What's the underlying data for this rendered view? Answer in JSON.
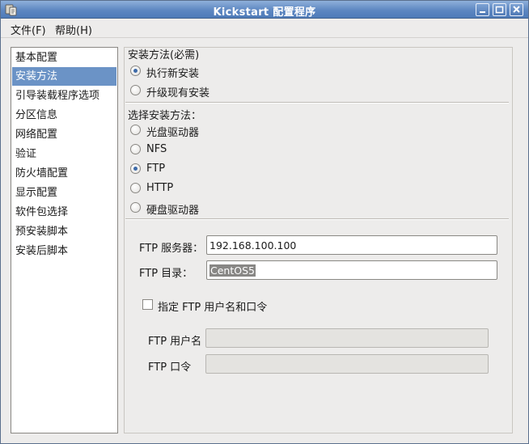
{
  "window": {
    "title": "Kickstart 配置程序",
    "controls": {
      "minimize": "minimize",
      "maximize": "maximize",
      "close": "close"
    }
  },
  "menubar": {
    "file": "文件(F)",
    "help": "帮助(H)"
  },
  "sidebar": {
    "items": [
      {
        "label": "基本配置"
      },
      {
        "label": "安装方法"
      },
      {
        "label": "引导装载程序选项"
      },
      {
        "label": "分区信息"
      },
      {
        "label": "网络配置"
      },
      {
        "label": "验证"
      },
      {
        "label": "防火墙配置"
      },
      {
        "label": "显示配置"
      },
      {
        "label": "软件包选择"
      },
      {
        "label": "预安装脚本"
      },
      {
        "label": "安装后脚本"
      }
    ],
    "selected": "安装方法"
  },
  "install_method": {
    "frame_label": "安装方法(必需)",
    "options": [
      {
        "label": "执行新安装",
        "checked": true
      },
      {
        "label": "升级现有安装",
        "checked": false
      }
    ]
  },
  "source": {
    "heading": "选择安装方法：",
    "options": [
      {
        "label": "光盘驱动器",
        "checked": false
      },
      {
        "label": "NFS",
        "checked": false
      },
      {
        "label": "FTP",
        "checked": true
      },
      {
        "label": "HTTP",
        "checked": false
      },
      {
        "label": "硬盘驱动器",
        "checked": false
      }
    ]
  },
  "ftp": {
    "server_label": "FTP 服务器：",
    "server_value": "192.168.100.100",
    "dir_label": "FTP 目录：",
    "dir_value": "CentOS5",
    "auth_checkbox_label": "指定 FTP 用户名和口令",
    "auth_checked": false,
    "username_label": "FTP 用户名",
    "username_value": "",
    "password_label": "FTP 口令",
    "password_value": ""
  },
  "colors": {
    "titlebar": "#5d87c2",
    "selection": "#6b93c6",
    "window_bg": "#edeceb"
  }
}
